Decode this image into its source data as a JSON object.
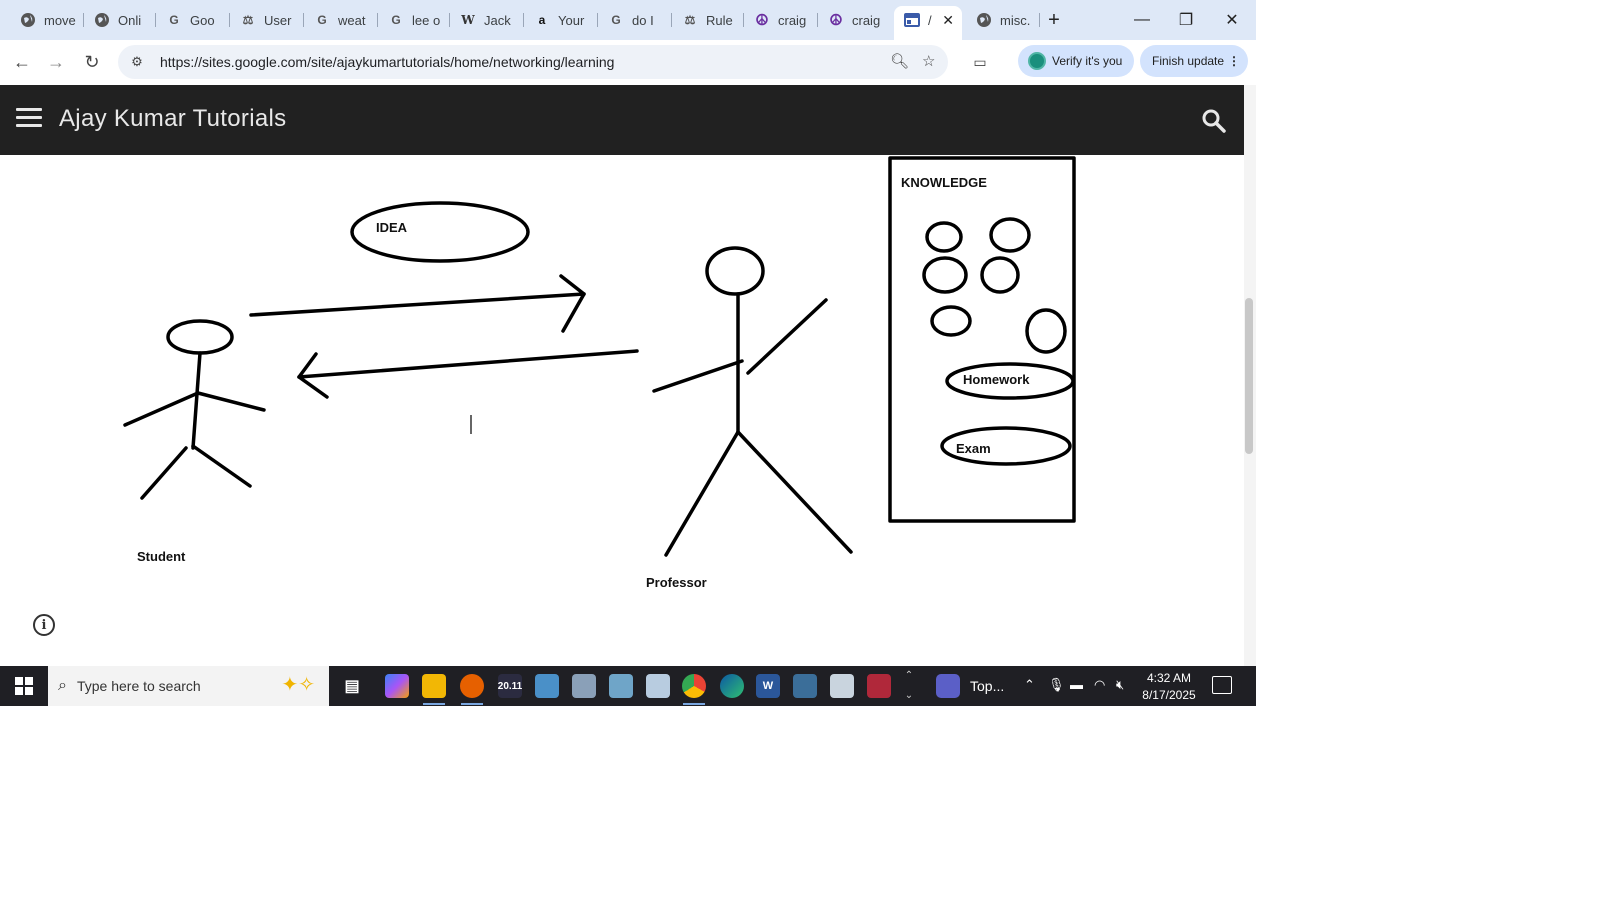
{
  "browser": {
    "tabs": [
      {
        "label": "move",
        "icon": "globe-icon"
      },
      {
        "label": "Onli",
        "icon": "globe-icon"
      },
      {
        "label": "Goo",
        "icon": "google-icon"
      },
      {
        "label": "User",
        "icon": "scales-icon"
      },
      {
        "label": "weat",
        "icon": "google-icon"
      },
      {
        "label": "lee o",
        "icon": "google-icon"
      },
      {
        "label": "Jack",
        "icon": "wikipedia-icon"
      },
      {
        "label": "Your",
        "icon": "amazon-icon"
      },
      {
        "label": "do I",
        "icon": "google-icon"
      },
      {
        "label": "Rule",
        "icon": "scales-icon"
      },
      {
        "label": "craig",
        "icon": "peace-icon"
      },
      {
        "label": "craig",
        "icon": "peace-icon"
      },
      {
        "label": "/",
        "icon": "sites-icon",
        "active": true
      },
      {
        "label": "misc.",
        "icon": "globe-icon"
      }
    ],
    "url": "https://sites.google.com/site/ajaykumartutorials/home/networking/learning",
    "verify_label": "Verify it's you",
    "finish_label": "Finish update"
  },
  "site": {
    "title": "Ajay Kumar Tutorials"
  },
  "diagram": {
    "labels": {
      "idea": "IDEA",
      "knowledge": "KNOWLEDGE",
      "homework": "Homework",
      "exam": "Exam",
      "student": "Student",
      "professor": "Professor"
    }
  },
  "taskbar": {
    "search_placeholder": "Type here to search",
    "teams_label": "Top...",
    "time": "4:32 AM",
    "date": "8/17/2025",
    "calendar_badge": "20.11"
  },
  "colors": {
    "tab_strip": "#dee8f7",
    "site_header": "#212121",
    "taskbar": "#1f1f24",
    "verify_pill": "#d3e3fd"
  }
}
